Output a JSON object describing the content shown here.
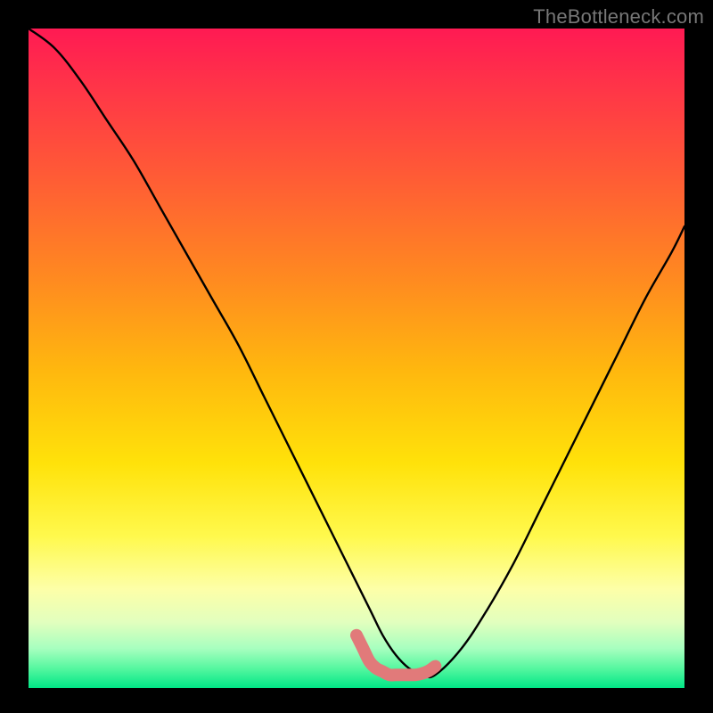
{
  "watermark": "TheBottleneck.com",
  "chart_data": {
    "type": "line",
    "title": "",
    "xlabel": "",
    "ylabel": "",
    "xlim": [
      0,
      100
    ],
    "ylim": [
      0,
      100
    ],
    "series": [
      {
        "name": "bottleneck-curve",
        "color": "#000000",
        "x": [
          0,
          4,
          8,
          12,
          16,
          20,
          24,
          28,
          32,
          36,
          40,
          44,
          48,
          52,
          54,
          56,
          58,
          60,
          62,
          66,
          70,
          74,
          78,
          82,
          86,
          90,
          94,
          98,
          100
        ],
        "y": [
          100,
          97,
          92,
          86,
          80,
          73,
          66,
          59,
          52,
          44,
          36,
          28,
          20,
          12,
          8,
          5,
          3,
          2,
          2,
          6,
          12,
          19,
          27,
          35,
          43,
          51,
          59,
          66,
          70
        ]
      },
      {
        "name": "accent-segment",
        "color": "#e17a7a",
        "x": [
          50,
          51,
          52,
          53,
          54,
          55,
          56,
          57,
          58,
          59,
          60,
          61,
          62
        ],
        "y": [
          8,
          6,
          4,
          3,
          2.5,
          2,
          2,
          2,
          2,
          2,
          2.2,
          2.6,
          3.3
        ]
      }
    ]
  },
  "colors": {
    "frame": "#000000",
    "watermark": "#777777",
    "accent": "#e17a7a"
  }
}
